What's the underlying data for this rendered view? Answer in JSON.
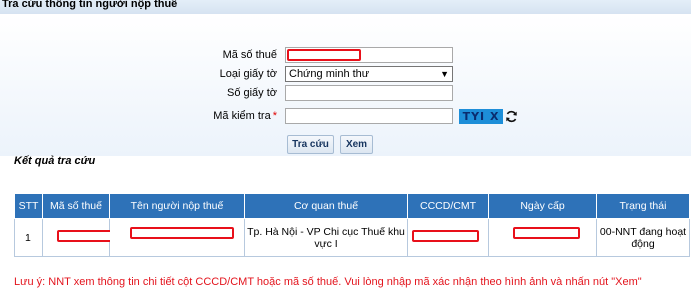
{
  "page": {
    "title": "Tra cứu thông tin người nộp thuế"
  },
  "form": {
    "tax_code_label": "Mã số thuế",
    "doc_type_label": "Loại giấy tờ",
    "doc_type_value": "Chứng minh thư",
    "doc_number_label": "Số giấy tờ",
    "captcha_label": "Mã kiểm tra",
    "captcha_required_mark": "*",
    "captcha_image_text": "TYI X"
  },
  "buttons": {
    "search": "Tra cứu",
    "view": "Xem"
  },
  "results": {
    "title": "Kết quả tra cứu",
    "headers": [
      "STT",
      "Mã số thuế",
      "Tên người nộp thuế",
      "Cơ quan thuế",
      "CCCD/CMT",
      "Ngày cấp",
      "Trạng thái"
    ],
    "rows": [
      {
        "stt": "1",
        "agency": "Tp. Hà Nội - VP Chi cục Thuế khu vực I",
        "status": "00-NNT đang hoạt động"
      }
    ]
  },
  "note": "Lưu ý: NNT xem thông tin chi tiết cột CCCD/CMT hoặc mã số thuế. Vui lòng nhập mã xác nhận theo hình ảnh và nhấn nút \"Xem\"",
  "colors": {
    "header_bg": "#2e72b8",
    "mask_red": "#e8101a",
    "note_red": "#e3141d",
    "captcha_bg": "#1d8ed8"
  }
}
